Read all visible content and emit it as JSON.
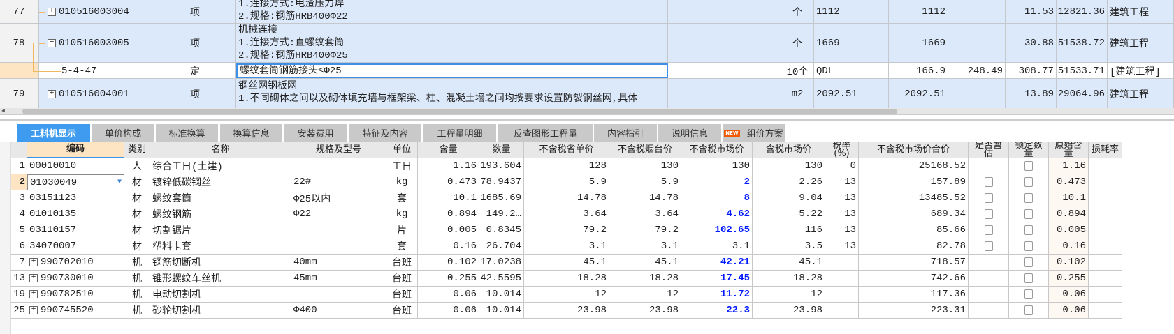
{
  "upper_table": {
    "rows": [
      {
        "num": "77",
        "code": "010516003004",
        "expand": "+",
        "type": "项",
        "desc": [
          "1.连接方式:电渣压力焊",
          "2.规格:钢筋HRB400Φ22"
        ],
        "unit": "个",
        "qty_expr": "1112",
        "qty": "1112",
        "price1": "",
        "price2": "11.53",
        "total": "12821.36",
        "category": "建筑工程"
      },
      {
        "num": "78",
        "code": "010516003005",
        "expand": "−",
        "type": "项",
        "desc": [
          "机械连接",
          "1.连接方式:直螺纹套筒",
          "2.规格:钢筋HRB400Φ25"
        ],
        "unit": "个",
        "qty_expr": "1669",
        "qty": "1669",
        "price1": "",
        "price2": "30.88",
        "total": "51538.72",
        "category": "建筑工程"
      },
      {
        "num": "",
        "code": "5-4-47",
        "expand": "",
        "type": "定",
        "desc": [
          "螺纹套筒钢筋接头≤Φ25"
        ],
        "unit": "10个",
        "qty_expr": "QDL",
        "qty": "166.9",
        "price1": "248.49",
        "price2": "308.77",
        "total": "51533.71",
        "category": "[建筑工程]"
      },
      {
        "num": "79",
        "code": "010516004001",
        "expand": "+",
        "type": "项",
        "desc": [
          "钢丝网钢板网",
          "1.不同砌体之间以及砌体填充墙与框架梁、柱、混凝土墙之间均按要求设置防裂钢丝网,具体"
        ],
        "unit": "m2",
        "qty_expr": "2092.51",
        "qty": "2092.51",
        "price1": "",
        "price2": "13.89",
        "total": "29064.96",
        "category": "建筑工程"
      }
    ]
  },
  "tabs": [
    {
      "label": "工料机显示",
      "active": true
    },
    {
      "label": "单价构成"
    },
    {
      "label": "标准换算"
    },
    {
      "label": "换算信息"
    },
    {
      "label": "安装费用"
    },
    {
      "label": "特征及内容"
    },
    {
      "label": "工程量明细"
    },
    {
      "label": "反查图形工程量"
    },
    {
      "label": "内容指引"
    },
    {
      "label": "说明信息"
    },
    {
      "label": "组价方案",
      "badge": "NEW"
    }
  ],
  "lower_table": {
    "headers": [
      "",
      "编码",
      "类别",
      "名称",
      "规格及型号",
      "单位",
      "含量",
      "数量",
      "不含税省单价",
      "不含税烟台价",
      "不含税市场价",
      "含税市场价",
      "税率(%)",
      "不含税市场价合价",
      "是否暂估",
      "锁定数量",
      "原始含量",
      "损耗率"
    ],
    "rows": [
      {
        "rn": "1",
        "code": "00010010",
        "expand": "",
        "type": "人",
        "name": "综合工日(土建)",
        "spec": "",
        "unit": "工日",
        "content": "1.16",
        "qty": "193.604",
        "prov": "128",
        "yt": "130",
        "market": "130",
        "market_blue": false,
        "tax_price": "130",
        "tax_rate": "0",
        "total": "25168.52",
        "est": null,
        "lock": false,
        "orig": "1.16"
      },
      {
        "rn": "2",
        "code": "01030049",
        "expand": "",
        "type": "材",
        "name": "镀锌低碳钢丝",
        "spec": "22#",
        "unit": "kg",
        "content": "0.473",
        "qty": "78.9437",
        "prov": "5.9",
        "yt": "5.9",
        "market": "2",
        "market_blue": true,
        "tax_price": "2.26",
        "tax_rate": "13",
        "total": "157.89",
        "est": false,
        "lock": false,
        "orig": "0.473",
        "selected": true
      },
      {
        "rn": "3",
        "code": "03151123",
        "expand": "",
        "type": "材",
        "name": "螺纹套筒",
        "spec": "Φ25以内",
        "unit": "套",
        "content": "10.1",
        "qty": "1685.69",
        "prov": "14.78",
        "yt": "14.78",
        "market": "8",
        "market_blue": true,
        "tax_price": "9.04",
        "tax_rate": "13",
        "total": "13485.52",
        "est": false,
        "lock": false,
        "orig": "10.1"
      },
      {
        "rn": "4",
        "code": "01010135",
        "expand": "",
        "type": "材",
        "name": "螺纹钢筋",
        "spec": "Φ22",
        "unit": "kg",
        "content": "0.894",
        "qty": "149.2…",
        "prov": "3.64",
        "yt": "3.64",
        "market": "4.62",
        "market_blue": true,
        "tax_price": "5.22",
        "tax_rate": "13",
        "total": "689.34",
        "est": false,
        "lock": false,
        "orig": "0.894"
      },
      {
        "rn": "5",
        "code": "03110157",
        "expand": "",
        "type": "材",
        "name": "切割锯片",
        "spec": "",
        "unit": "片",
        "content": "0.005",
        "qty": "0.8345",
        "prov": "79.2",
        "yt": "79.2",
        "market": "102.65",
        "market_blue": true,
        "tax_price": "116",
        "tax_rate": "13",
        "total": "85.66",
        "est": false,
        "lock": false,
        "orig": "0.005"
      },
      {
        "rn": "6",
        "code": "34070007",
        "expand": "",
        "type": "材",
        "name": "塑料卡套",
        "spec": "",
        "unit": "套",
        "content": "0.16",
        "qty": "26.704",
        "prov": "3.1",
        "yt": "3.1",
        "market": "3.1",
        "market_blue": false,
        "tax_price": "3.5",
        "tax_rate": "13",
        "total": "82.78",
        "est": false,
        "lock": false,
        "orig": "0.16"
      },
      {
        "rn": "7",
        "code": "990702010",
        "expand": "+",
        "type": "机",
        "name": "钢筋切断机",
        "spec": "40mm",
        "unit": "台班",
        "content": "0.102",
        "qty": "17.0238",
        "prov": "45.1",
        "yt": "45.1",
        "market": "42.21",
        "market_blue": true,
        "tax_price": "45.1",
        "tax_rate": "",
        "total": "718.57",
        "est": null,
        "lock": false,
        "orig": "0.102"
      },
      {
        "rn": "13",
        "code": "990730010",
        "expand": "+",
        "type": "机",
        "name": "锥形螺纹车丝机",
        "spec": "45mm",
        "unit": "台班",
        "content": "0.255",
        "qty": "42.5595",
        "prov": "18.28",
        "yt": "18.28",
        "market": "17.45",
        "market_blue": true,
        "tax_price": "18.28",
        "tax_rate": "",
        "total": "742.66",
        "est": null,
        "lock": false,
        "orig": "0.255"
      },
      {
        "rn": "19",
        "code": "990782510",
        "expand": "+",
        "type": "机",
        "name": "电动切割机",
        "spec": "",
        "unit": "台班",
        "content": "0.06",
        "qty": "10.014",
        "prov": "12",
        "yt": "12",
        "market": "11.72",
        "market_blue": true,
        "tax_price": "12",
        "tax_rate": "",
        "total": "117.36",
        "est": null,
        "lock": false,
        "orig": "0.06"
      },
      {
        "rn": "25",
        "code": "990745520",
        "expand": "+",
        "type": "机",
        "name": "砂轮切割机",
        "spec": "Φ400",
        "unit": "台班",
        "content": "0.06",
        "qty": "10.014",
        "prov": "23.98",
        "yt": "23.98",
        "market": "22.3",
        "market_blue": true,
        "tax_price": "23.98",
        "tax_rate": "",
        "total": "223.31",
        "est": null,
        "lock": false,
        "orig": "0.06"
      }
    ]
  }
}
